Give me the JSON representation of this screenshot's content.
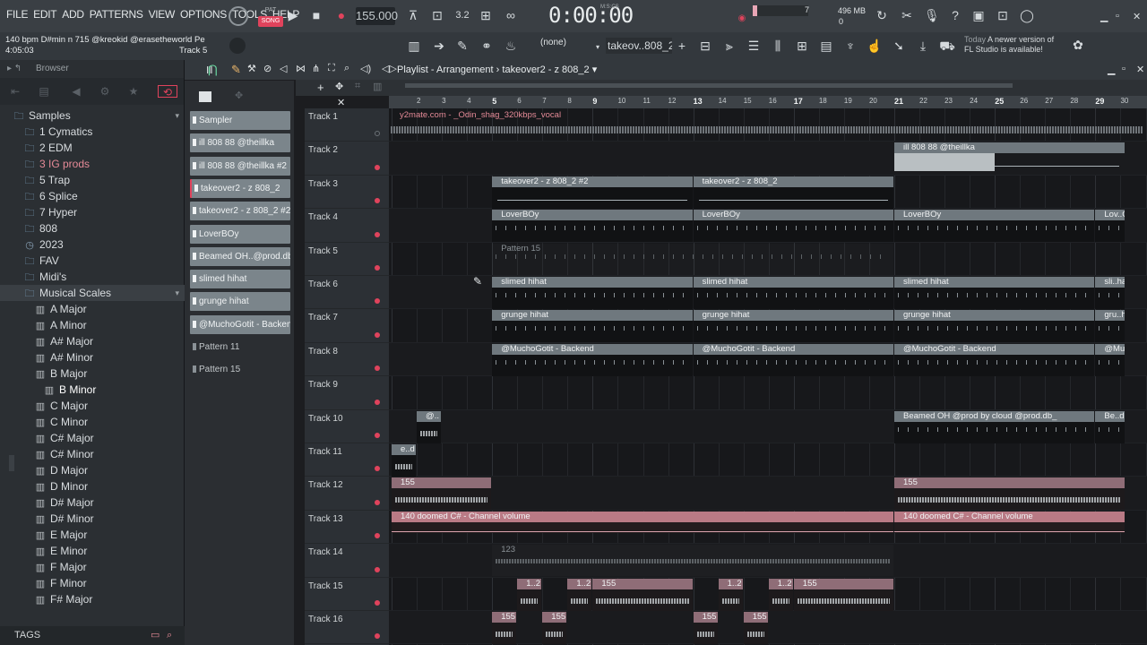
{
  "menu": [
    "FILE",
    "EDIT",
    "ADD",
    "PATTERNS",
    "VIEW",
    "OPTIONS",
    "TOOLS",
    "HELP"
  ],
  "transport": {
    "pat_label": "PAT",
    "song_label": "SONG",
    "tempo": "155.000",
    "time": "0:00:00",
    "time_unit": "M:S:CS",
    "cpu": "7",
    "memory": "496 MB",
    "voices": "0"
  },
  "info": {
    "line1": "140 bpm D#min n 715 @kreokid @erasetheworld Pe",
    "line2": "4:05:03",
    "track": "Track 5"
  },
  "toolbar2": {
    "none_label": "(none)",
    "pattern_name": "takeov..808_2",
    "update_today": "Today",
    "update_msg1": "A newer version of",
    "update_msg2": "FL Studio is available!"
  },
  "browser": {
    "title": "Browser",
    "tags_label": "TAGS",
    "items": [
      {
        "label": "Samples",
        "icon": "folder-icon",
        "indent": 14,
        "style": "root"
      },
      {
        "label": "1 Cymatics",
        "icon": "folder-icon",
        "indent": 26,
        "style": ""
      },
      {
        "label": "2 EDM",
        "icon": "folder-icon",
        "indent": 26,
        "style": ""
      },
      {
        "label": "3 IG prods",
        "icon": "folder-icon",
        "indent": 26,
        "style": "red"
      },
      {
        "label": "5 Trap",
        "icon": "folder-icon",
        "indent": 26,
        "style": ""
      },
      {
        "label": "6 Splice",
        "icon": "folder-icon",
        "indent": 26,
        "style": ""
      },
      {
        "label": "7 Hyper",
        "icon": "folder-icon",
        "indent": 26,
        "style": ""
      },
      {
        "label": "808",
        "icon": "folder-icon",
        "indent": 26,
        "style": ""
      },
      {
        "label": "2023",
        "icon": "clock-icon",
        "indent": 26,
        "style": ""
      },
      {
        "label": "FAV",
        "icon": "folder-icon",
        "indent": 26,
        "style": ""
      },
      {
        "label": "Midi's",
        "icon": "folder-icon",
        "indent": 26,
        "style": ""
      },
      {
        "label": "Musical Scales",
        "icon": "folder-icon",
        "indent": 26,
        "style": "sel"
      },
      {
        "label": "A Major",
        "icon": "scale-icon",
        "indent": 38,
        "style": ""
      },
      {
        "label": "A Minor",
        "icon": "scale-icon",
        "indent": 38,
        "style": ""
      },
      {
        "label": "A# Major",
        "icon": "scale-icon",
        "indent": 38,
        "style": ""
      },
      {
        "label": "A# Minor",
        "icon": "scale-icon",
        "indent": 38,
        "style": ""
      },
      {
        "label": "B Major",
        "icon": "scale-icon",
        "indent": 38,
        "style": ""
      },
      {
        "label": "B Minor",
        "icon": "scale-icon",
        "indent": 48,
        "style": "hl"
      },
      {
        "label": "C Major",
        "icon": "scale-icon",
        "indent": 38,
        "style": ""
      },
      {
        "label": "C Minor",
        "icon": "scale-icon",
        "indent": 38,
        "style": ""
      },
      {
        "label": "C# Major",
        "icon": "scale-icon",
        "indent": 38,
        "style": ""
      },
      {
        "label": "C# Minor",
        "icon": "scale-icon",
        "indent": 38,
        "style": ""
      },
      {
        "label": "D Major",
        "icon": "scale-icon",
        "indent": 38,
        "style": ""
      },
      {
        "label": "D Minor",
        "icon": "scale-icon",
        "indent": 38,
        "style": ""
      },
      {
        "label": "D# Major",
        "icon": "scale-icon",
        "indent": 38,
        "style": ""
      },
      {
        "label": "D# Minor",
        "icon": "scale-icon",
        "indent": 38,
        "style": ""
      },
      {
        "label": "E Major",
        "icon": "scale-icon",
        "indent": 38,
        "style": ""
      },
      {
        "label": "E Minor",
        "icon": "scale-icon",
        "indent": 38,
        "style": ""
      },
      {
        "label": "F Major",
        "icon": "scale-icon",
        "indent": 38,
        "style": ""
      },
      {
        "label": "F Minor",
        "icon": "scale-icon",
        "indent": 38,
        "style": ""
      },
      {
        "label": "F# Major",
        "icon": "scale-icon",
        "indent": 38,
        "style": ""
      }
    ]
  },
  "picker": [
    {
      "label": "Sampler",
      "kind": "channel"
    },
    {
      "label": "ill 808 88 @theillka",
      "kind": "channel"
    },
    {
      "label": "ill 808 88 @theillka #2",
      "kind": "channel"
    },
    {
      "label": "takeover2 - z 808_2",
      "kind": "channel",
      "selected": true
    },
    {
      "label": "takeover2 - z 808_2 #2",
      "kind": "channel"
    },
    {
      "label": "LoverBOy",
      "kind": "channel"
    },
    {
      "label": "Beamed OH..@prod.db_",
      "kind": "channel"
    },
    {
      "label": "slimed hihat",
      "kind": "channel"
    },
    {
      "label": "grunge hihat",
      "kind": "channel"
    },
    {
      "label": "@MuchoGotit - Backend",
      "kind": "channel"
    },
    {
      "label": "Pattern 11",
      "kind": "pattern"
    },
    {
      "label": "Pattern 15",
      "kind": "pattern"
    }
  ],
  "playlist": {
    "title": "Playlist - Arrangement",
    "sep": "›",
    "pattern": "takeover2 - z 808_2",
    "ruler": [
      "2",
      "3",
      "4",
      "5",
      "6",
      "7",
      "8",
      "9",
      "10",
      "11",
      "12",
      "13",
      "14",
      "15",
      "16",
      "17",
      "18",
      "19",
      "20",
      "21",
      "22",
      "23",
      "24",
      "25",
      "26",
      "27",
      "28",
      "29",
      "30"
    ],
    "ruler_major": [
      "5",
      "9",
      "13",
      "17",
      "21",
      "25",
      "29"
    ],
    "tracks": [
      "Track 1",
      "Track 2",
      "Track 3",
      "Track 4",
      "Track 5",
      "Track 6",
      "Track 7",
      "Track 8",
      "Track 9",
      "Track 10",
      "Track 11",
      "Track 12",
      "Track 13",
      "Track 14",
      "Track 15",
      "Track 16"
    ],
    "track1_audio": "y2mate.com - _Odin_shag_320kbps_vocal",
    "clips": [
      {
        "track": 2,
        "start": 21,
        "end": 30.2,
        "label": "ill 808 88 @theillka",
        "style": "gray",
        "content": "line"
      },
      {
        "track": 3,
        "start": 5,
        "end": 13,
        "label": "takeover2 - z 808_2 #2",
        "style": "gray",
        "content": "line"
      },
      {
        "track": 3,
        "start": 13,
        "end": 21,
        "label": "takeover2 - z 808_2",
        "style": "gray",
        "content": "line"
      },
      {
        "track": 4,
        "start": 5,
        "end": 13,
        "label": "LoverBOy",
        "style": "gray",
        "content": "ticks"
      },
      {
        "track": 4,
        "start": 13,
        "end": 21,
        "label": "LoverBOy",
        "style": "gray",
        "content": "ticks"
      },
      {
        "track": 4,
        "start": 21,
        "end": 29,
        "label": "LoverBOy",
        "style": "gray",
        "content": "ticks"
      },
      {
        "track": 4,
        "start": 29,
        "end": 30.2,
        "label": "Lov..Oy",
        "style": "gray",
        "content": "ticks"
      },
      {
        "track": 5,
        "start": 5,
        "end": 21,
        "label": "Pattern 15",
        "style": "ghost",
        "content": "ticks"
      },
      {
        "track": 6,
        "start": 5,
        "end": 13,
        "label": "slimed hihat",
        "style": "gray",
        "content": "ticks"
      },
      {
        "track": 6,
        "start": 13,
        "end": 21,
        "label": "slimed hihat",
        "style": "gray",
        "content": "ticks"
      },
      {
        "track": 6,
        "start": 21,
        "end": 29,
        "label": "slimed hihat",
        "style": "gray",
        "content": "ticks"
      },
      {
        "track": 6,
        "start": 29,
        "end": 30.2,
        "label": "sli..hat",
        "style": "gray",
        "content": "ticks"
      },
      {
        "track": 7,
        "start": 5,
        "end": 13,
        "label": "grunge hihat",
        "style": "gray",
        "content": "ticks"
      },
      {
        "track": 7,
        "start": 13,
        "end": 21,
        "label": "grunge hihat",
        "style": "gray",
        "content": "ticks"
      },
      {
        "track": 7,
        "start": 21,
        "end": 29,
        "label": "grunge hihat",
        "style": "gray",
        "content": "ticks"
      },
      {
        "track": 7,
        "start": 29,
        "end": 30.2,
        "label": "gru..hat",
        "style": "gray",
        "content": "ticks"
      },
      {
        "track": 8,
        "start": 5,
        "end": 13,
        "label": "@MuchoGotit - Backend",
        "style": "gray",
        "content": "ticks"
      },
      {
        "track": 8,
        "start": 13,
        "end": 21,
        "label": "@MuchoGotit - Backend",
        "style": "gray",
        "content": "ticks"
      },
      {
        "track": 8,
        "start": 21,
        "end": 29,
        "label": "@MuchoGotit - Backend",
        "style": "gray",
        "content": "ticks"
      },
      {
        "track": 8,
        "start": 29,
        "end": 30.2,
        "label": "@Mu..d",
        "style": "gray",
        "content": "ticks"
      },
      {
        "track": 10,
        "start": 2,
        "end": 3,
        "label": "@..",
        "style": "gray",
        "content": "wave"
      },
      {
        "track": 10,
        "start": 21,
        "end": 29,
        "label": "Beamed OH @prod by cloud @prod.db_",
        "style": "gray",
        "content": "ticks"
      },
      {
        "track": 10,
        "start": 29,
        "end": 30.2,
        "label": "Be..db",
        "style": "gray",
        "content": "ticks"
      },
      {
        "track": 11,
        "start": 1,
        "end": 2,
        "label": "e..d",
        "style": "gray",
        "content": "wave"
      },
      {
        "track": 12,
        "start": 1,
        "end": 5,
        "label": "155",
        "style": "pink",
        "content": "wave"
      },
      {
        "track": 12,
        "start": 21,
        "end": 30.2,
        "label": "155",
        "style": "pink",
        "content": "wave"
      },
      {
        "track": 13,
        "start": 1,
        "end": 21,
        "label": "140 doomed C# - Channel volume",
        "style": "auto",
        "content": "none"
      },
      {
        "track": 13,
        "start": 21,
        "end": 30.2,
        "label": "140 doomed C# - Channel volume",
        "style": "auto",
        "content": "none"
      },
      {
        "track": 14,
        "start": 5,
        "end": 21,
        "label": "123",
        "style": "ghost",
        "content": "wave"
      },
      {
        "track": 15,
        "start": 6,
        "end": 7,
        "label": "1..2",
        "style": "pink",
        "content": "wave"
      },
      {
        "track": 15,
        "start": 8,
        "end": 9,
        "label": "1..2",
        "style": "pink",
        "content": "wave"
      },
      {
        "track": 15,
        "start": 9,
        "end": 13,
        "label": "155",
        "style": "pink",
        "content": "wave"
      },
      {
        "track": 15,
        "start": 14,
        "end": 15,
        "label": "1..2",
        "style": "pink",
        "content": "wave"
      },
      {
        "track": 15,
        "start": 16,
        "end": 17,
        "label": "1..2",
        "style": "pink",
        "content": "wave"
      },
      {
        "track": 15,
        "start": 17,
        "end": 21,
        "label": "155",
        "style": "pink",
        "content": "wave"
      },
      {
        "track": 16,
        "start": 5,
        "end": 6,
        "label": "155",
        "style": "pink",
        "content": "wave"
      },
      {
        "track": 16,
        "start": 7,
        "end": 8,
        "label": "155",
        "style": "pink",
        "content": "wave"
      },
      {
        "track": 16,
        "start": 13,
        "end": 14,
        "label": "155",
        "style": "pink",
        "content": "wave"
      },
      {
        "track": 16,
        "start": 15,
        "end": 16,
        "label": "155",
        "style": "pink",
        "content": "wave"
      }
    ]
  },
  "colors": {
    "accent": "#e0435c",
    "clip_gray": "#6f787e",
    "clip_pink": "#8f6d77",
    "automation": "#b97a85"
  }
}
